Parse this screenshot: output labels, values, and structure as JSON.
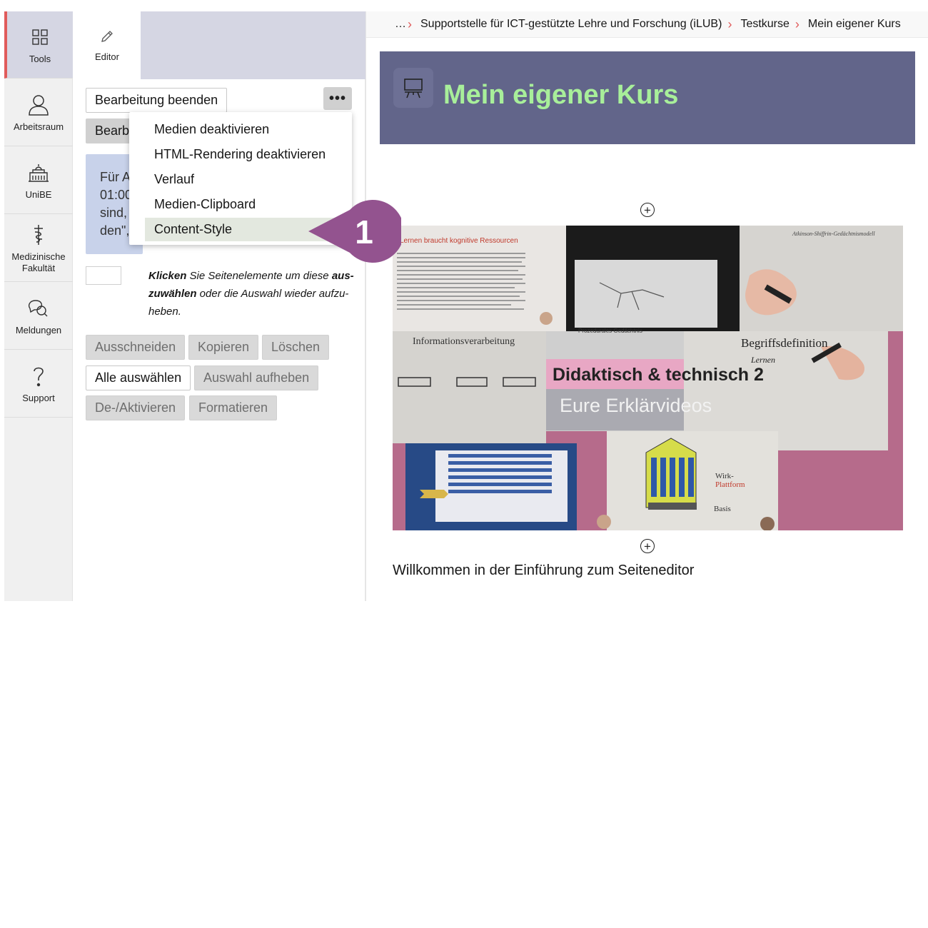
{
  "mainbar": {
    "items": [
      {
        "label": "Tools",
        "icon": "grid-icon"
      },
      {
        "label": "Arbeitsraum",
        "icon": "person-icon"
      },
      {
        "label": "UniBE",
        "icon": "building-icon"
      },
      {
        "label": "Medizinische Fakultät",
        "icon": "caduceus-icon"
      },
      {
        "label": "Meldungen",
        "icon": "chat-bubbles-icon"
      },
      {
        "label": "Support",
        "icon": "question-icon"
      }
    ]
  },
  "slate": {
    "tab_label": "Editor",
    "finish_label": "Bearbeitung beenden",
    "second_button_label": "Bearb",
    "more_label": "•••",
    "info_text_lines": [
      "Für A",
      "01:00",
      "sind,",
      "den\","
    ],
    "hint": {
      "part1": "Klicken",
      "part2": " Sie Seitenelemente um diese ",
      "part3": "aus-zuwählen",
      "part4": " oder die Auswahl wieder aufzu-heben."
    },
    "actions": {
      "cut": "Ausschneiden",
      "copy": "Kopieren",
      "delete": "Löschen",
      "select_all": "Alle auswählen",
      "deselect": "Auswahl aufheben",
      "toggle": "De-/Aktivieren",
      "format": "Formatieren"
    }
  },
  "dropdown": {
    "items": [
      "Medien deaktivieren",
      "HTML-Rendering deaktivieren",
      "Verlauf",
      "Medien-Clipboard",
      "Content-Style"
    ]
  },
  "callout": {
    "number": "1",
    "color": "#93538f"
  },
  "breadcrumb": {
    "ellipsis": "…",
    "items": [
      "Supportstelle für ICT-gestützte Lehre und Forschung (iLUB)",
      "Testkurse",
      "Mein eigener Kurs"
    ]
  },
  "content": {
    "title": "Mein eigener Kurs",
    "title_color": "#a8ef9a",
    "header_color": "#62658a",
    "add_symbol": "+",
    "banner": {
      "slide_title": "Lernen braucht kognitive Ressourcen",
      "note_top_right": "Atkinson-Shiffrin-Gedächtnismodell",
      "note_info": "Informationsverarbeitung",
      "note_def": "Begriffsdefinition",
      "note_def2": "Lernen",
      "note_proc": "Prozedurales Gedächtnis",
      "headline": "Didaktisch & technisch 2",
      "subline": "Eure Erklärvideos",
      "note_wirk": "Wirk-",
      "note_wirk2": "Plattform",
      "note_basis": "Basis"
    },
    "welcome": "Willkommen in der Einführung zum Seiteneditor"
  }
}
